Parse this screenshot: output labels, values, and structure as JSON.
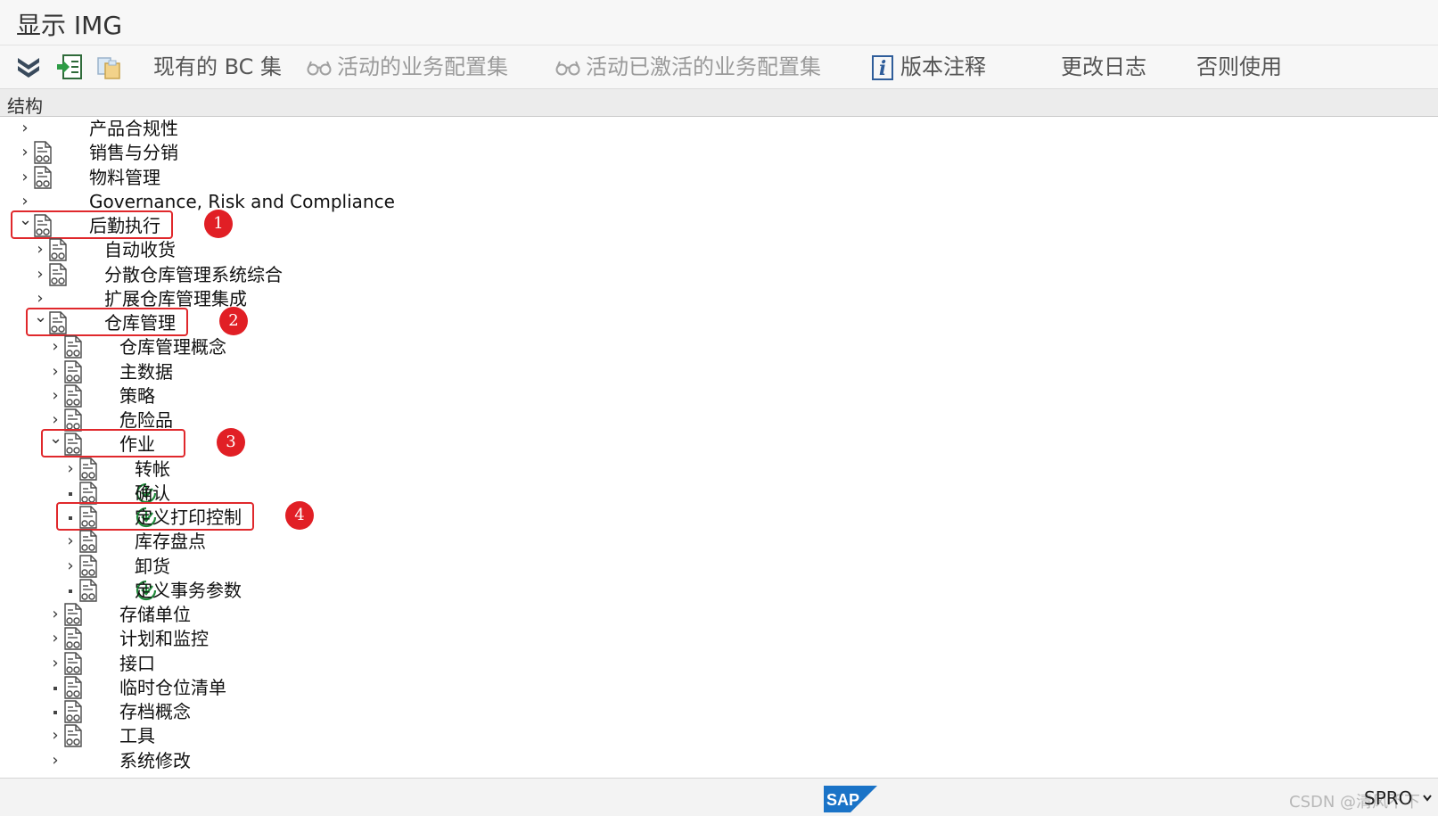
{
  "window": {
    "title": "显示 IMG"
  },
  "toolbar": {
    "icons": [
      "expand-all-icon",
      "position-tree-icon",
      "copy-icon"
    ],
    "buttons": [
      {
        "label": "现有的 BC 集",
        "enabled": true
      },
      {
        "label": "活动的业务配置集",
        "enabled": false,
        "icon": "glasses-icon"
      },
      {
        "label": "活动已激活的业务配置集",
        "enabled": false,
        "icon": "glasses-icon"
      },
      {
        "label": "版本注释",
        "enabled": true,
        "icon": "info-icon"
      },
      {
        "label": "更改日志",
        "enabled": true
      },
      {
        "label": "否则使用",
        "enabled": true
      }
    ]
  },
  "structure": {
    "header": "结构",
    "rows": [
      {
        "label": "产品合规性",
        "level": 0,
        "state": "collapsed",
        "doc": false,
        "exec": false
      },
      {
        "label": "销售与分销",
        "level": 0,
        "state": "collapsed",
        "doc": true,
        "exec": false
      },
      {
        "label": "物料管理",
        "level": 0,
        "state": "collapsed",
        "doc": true,
        "exec": false
      },
      {
        "label": "Governance, Risk and Compliance",
        "level": 0,
        "state": "collapsed",
        "doc": false,
        "exec": false
      },
      {
        "label": "后勤执行",
        "level": 0,
        "state": "expanded",
        "doc": true,
        "exec": false,
        "marker": "1"
      },
      {
        "label": "自动收货",
        "level": 1,
        "state": "collapsed",
        "doc": true,
        "exec": false
      },
      {
        "label": "分散仓库管理系统综合",
        "level": 1,
        "state": "collapsed",
        "doc": true,
        "exec": false
      },
      {
        "label": "扩展仓库管理集成",
        "level": 1,
        "state": "collapsed",
        "doc": false,
        "exec": false
      },
      {
        "label": "仓库管理",
        "level": 1,
        "state": "expanded",
        "doc": true,
        "exec": false,
        "marker": "2"
      },
      {
        "label": "仓库管理概念",
        "level": 2,
        "state": "collapsed",
        "doc": true,
        "exec": false
      },
      {
        "label": "主数据",
        "level": 2,
        "state": "collapsed",
        "doc": true,
        "exec": false
      },
      {
        "label": "策略",
        "level": 2,
        "state": "collapsed",
        "doc": true,
        "exec": false
      },
      {
        "label": "危险品",
        "level": 2,
        "state": "collapsed",
        "doc": true,
        "exec": false
      },
      {
        "label": "作业",
        "level": 2,
        "state": "expanded",
        "doc": true,
        "exec": false,
        "marker": "3"
      },
      {
        "label": "转帐",
        "level": 3,
        "state": "collapsed",
        "doc": true,
        "exec": false
      },
      {
        "label": "确认",
        "level": 3,
        "state": "leaf",
        "doc": true,
        "exec": true
      },
      {
        "label": "定义打印控制",
        "level": 3,
        "state": "leaf",
        "doc": true,
        "exec": true,
        "marker": "4"
      },
      {
        "label": "库存盘点",
        "level": 3,
        "state": "collapsed",
        "doc": true,
        "exec": false
      },
      {
        "label": "卸货",
        "level": 3,
        "state": "collapsed",
        "doc": true,
        "exec": false
      },
      {
        "label": "定义事务参数",
        "level": 3,
        "state": "leaf",
        "doc": true,
        "exec": true
      },
      {
        "label": "存储单位",
        "level": 2,
        "state": "collapsed",
        "doc": true,
        "exec": false
      },
      {
        "label": "计划和监控",
        "level": 2,
        "state": "collapsed",
        "doc": true,
        "exec": false
      },
      {
        "label": "接口",
        "level": 2,
        "state": "collapsed",
        "doc": true,
        "exec": false
      },
      {
        "label": "临时仓位清单",
        "level": 2,
        "state": "leaf",
        "doc": true,
        "exec": false
      },
      {
        "label": "存档概念",
        "level": 2,
        "state": "leaf",
        "doc": true,
        "exec": false
      },
      {
        "label": "工具",
        "level": 2,
        "state": "collapsed",
        "doc": true,
        "exec": false
      },
      {
        "label": "系统修改",
        "level": 2,
        "state": "collapsed",
        "doc": false,
        "exec": false
      }
    ]
  },
  "status_bar": {
    "logo": "SAP",
    "transaction": "SPRO",
    "watermark": "CSDN @清风不下"
  },
  "colors": {
    "highlight": "#e0282c",
    "badge": "#e11f25",
    "exec_icon": "#1f8a3a",
    "sap_logo": "#1a73c7"
  }
}
